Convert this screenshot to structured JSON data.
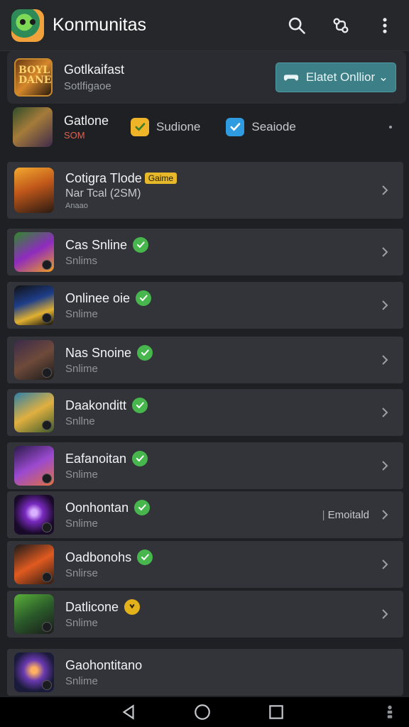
{
  "app": {
    "title": "Konmunitas",
    "icons": [
      "search-icon",
      "share-icon",
      "more-vert-icon"
    ]
  },
  "featured": {
    "thumb_text": "BOYL DANE",
    "title": "Gotlkaifast",
    "subtitle": "Sotlfigaoe",
    "button_label": "Elatet Onllior ⌄",
    "button_color": "#3c7f87"
  },
  "row2": {
    "title": "Gatlone",
    "subtitle": "SOM",
    "chips": [
      {
        "label": "Sudione",
        "icon": "check-box-icon",
        "color": "#f0b429"
      },
      {
        "label": "Seaiode",
        "icon": "check-box-icon",
        "color": "#2f9be0"
      }
    ]
  },
  "highlight": {
    "title": "Cotigra Tlode",
    "badge": "Gaime",
    "subtitle": "Nar Tcal (2SM)",
    "meta": "Anaao"
  },
  "items": [
    {
      "title": "Cas Snline",
      "sub": "Snlims",
      "badge": "check"
    },
    {
      "title": "Onlinee oie",
      "sub": "Snlime",
      "badge": "check"
    },
    {
      "title": "Nas Snoine",
      "sub": "Snlime",
      "badge": "check"
    },
    {
      "title": "Daakonditt",
      "sub": "Snllne",
      "badge": "check"
    },
    {
      "title": "Eafanoitan",
      "sub": "Snlime",
      "badge": "check"
    },
    {
      "title": "Oonhontan",
      "sub": "Snlime",
      "badge": "check",
      "extra": "Emoitald"
    },
    {
      "title": "Oadbonohs",
      "sub": "Snlirse",
      "badge": "check"
    },
    {
      "title": "Datlicone",
      "sub": "Snlime",
      "badge": "amber"
    },
    {
      "title": "Gaohontitano",
      "sub": "Snlime",
      "badge": "none"
    }
  ],
  "navbar": {
    "icons": [
      "back-icon",
      "home-icon",
      "recents-icon",
      "accessibility-icon"
    ]
  }
}
